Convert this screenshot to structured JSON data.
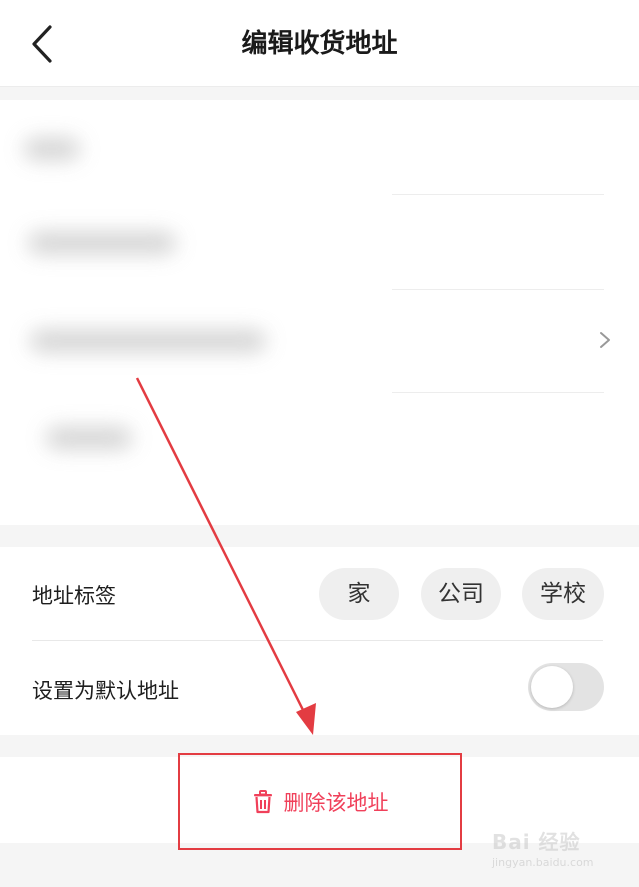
{
  "header": {
    "title": "编辑收货地址",
    "back_icon": "chevron-left-icon"
  },
  "address_form": {
    "rows": [
      "name-field",
      "phone-field",
      "region-field",
      "detail-address-field"
    ],
    "region_icon": "chevron-right-icon"
  },
  "address_tag": {
    "label": "地址标签",
    "options": [
      "家",
      "公司",
      "学校"
    ]
  },
  "default_address": {
    "label": "设置为默认地址",
    "enabled": false
  },
  "delete": {
    "label": "删除该地址",
    "icon": "trash-icon",
    "color": "#f0405a"
  },
  "annotation": {
    "color": "#e33c42"
  },
  "watermark": {
    "brand": "Bai 经验",
    "url": "jingyan.baidu.com"
  },
  "colors": {
    "accent": "#f0405a",
    "background": "#f5f5f5",
    "card": "#ffffff"
  }
}
